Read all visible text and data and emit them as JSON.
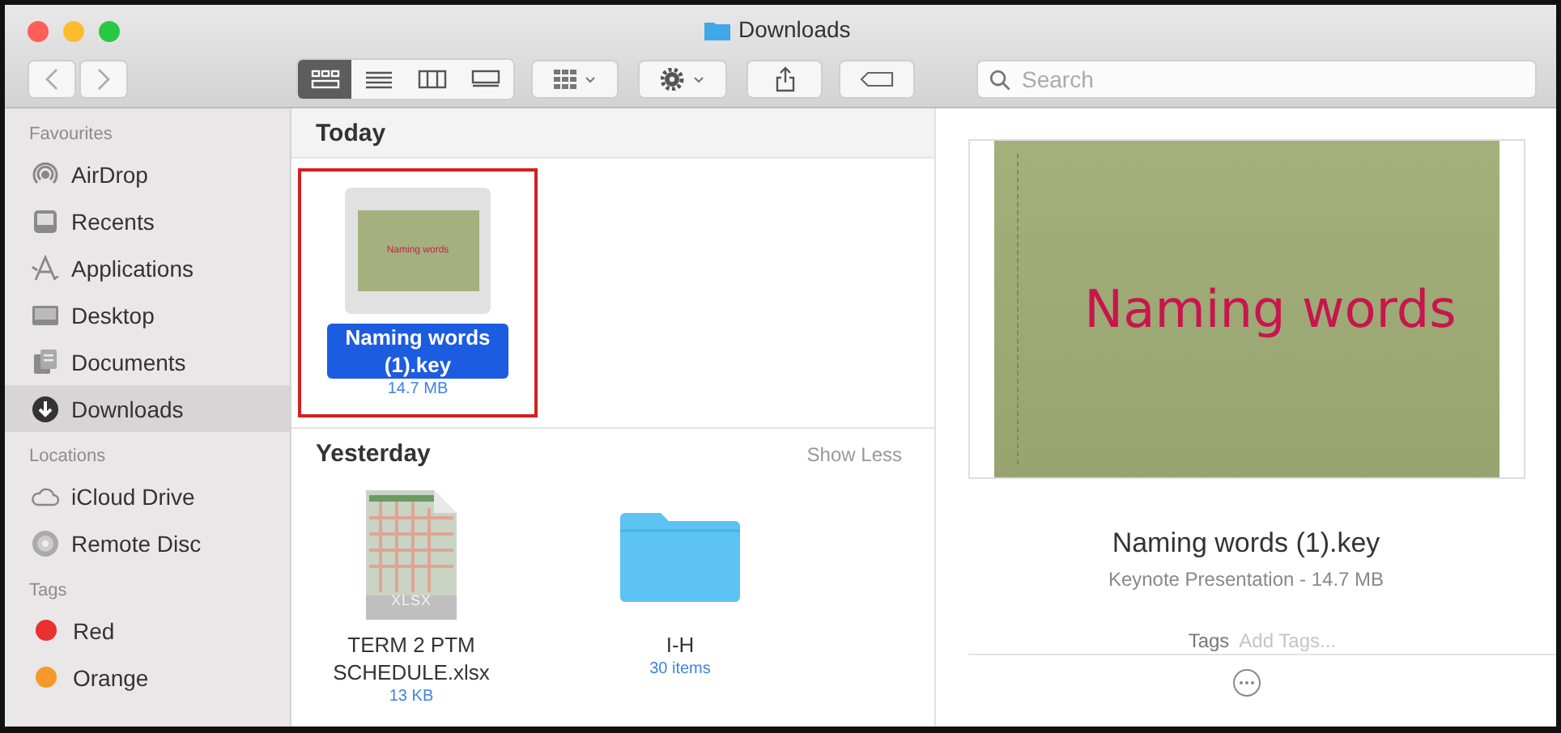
{
  "window": {
    "title": "Downloads"
  },
  "toolbar": {
    "view_modes": [
      {
        "kind": "icons",
        "selected": true
      },
      {
        "kind": "list",
        "selected": false
      },
      {
        "kind": "columns",
        "selected": false
      },
      {
        "kind": "gallery",
        "selected": false
      }
    ],
    "search": {
      "placeholder": "Search"
    }
  },
  "sidebar": {
    "sections": [
      {
        "heading": "Favourites",
        "items": [
          {
            "label": "AirDrop",
            "kind": "airdrop",
            "selected": false
          },
          {
            "label": "Recents",
            "kind": "recents",
            "selected": false
          },
          {
            "label": "Applications",
            "kind": "applications",
            "selected": false
          },
          {
            "label": "Desktop",
            "kind": "desktop",
            "selected": false
          },
          {
            "label": "Documents",
            "kind": "documents",
            "selected": false
          },
          {
            "label": "Downloads",
            "kind": "downloads",
            "selected": true
          }
        ]
      },
      {
        "heading": "Locations",
        "items": [
          {
            "label": "iCloud Drive",
            "kind": "cloud",
            "selected": false
          },
          {
            "label": "Remote Disc",
            "kind": "disc",
            "selected": false
          }
        ]
      },
      {
        "heading": "Tags",
        "items": [
          {
            "label": "Red",
            "kind": "tag",
            "color": "#ec2f2f",
            "selected": false
          },
          {
            "label": "Orange",
            "kind": "tag",
            "color": "#f59a2a",
            "selected": false
          }
        ]
      }
    ]
  },
  "groups": [
    {
      "heading": "Today",
      "files": [
        {
          "name": "Naming words (1).key",
          "size": "14.7 MB",
          "kind": "keynote",
          "selected": true,
          "highlighted": true,
          "thumbnail_text": "Naming words"
        }
      ]
    },
    {
      "heading": "Yesterday",
      "action": "Show Less",
      "files": [
        {
          "name": "TERM 2 PTM SCHEDULE.xlsx",
          "size": "13 KB",
          "kind": "spreadsheet",
          "badge": "XLSX",
          "selected": false,
          "highlighted": false
        },
        {
          "name": "I-H",
          "size": "30 items",
          "kind": "folder",
          "selected": false,
          "highlighted": false
        }
      ]
    }
  ],
  "preview": {
    "slide_text": "Naming words",
    "name": "Naming words (1).key",
    "info": "Keynote Presentation - 14.7 MB",
    "tags_label": "Tags",
    "tags_placeholder": "Add Tags..."
  }
}
